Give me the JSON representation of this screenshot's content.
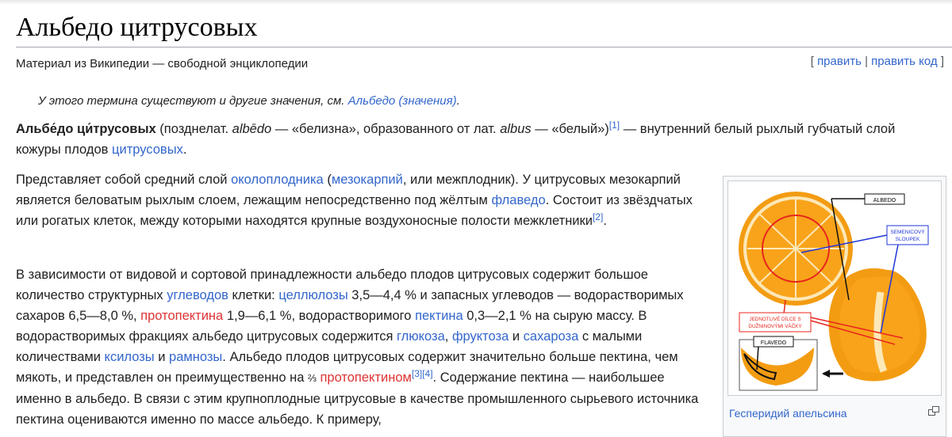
{
  "page": {
    "title": "Альбедо цитрусовых",
    "subtitle": "Материал из Википедии — свободной энциклопедии",
    "edit": "править",
    "edit_code": "править код"
  },
  "hatnote": {
    "text": "У этого термина существуют и другие значения, см. ",
    "link": "Альбедо (значения)",
    "end": "."
  },
  "p1": {
    "term": "Альбе́до ци́трусовых",
    "t1": " (позднелат. ",
    "w1": "albēdo",
    "t2": " — «белизна», образованного от лат. ",
    "w2": "albus",
    "t3": " — «белый»)",
    "ref1": "[1]",
    "t4": " — внутренний белый рыхлый губчатый слой кожуры плодов ",
    "link": "цитрусовых",
    "t5": "."
  },
  "p2": {
    "t1": "Представляет собой средний слой ",
    "l1": "околоплодника",
    "t2": " (",
    "l2": "мезокарпий",
    "t3": ", или межплодник). У цитрусовых мезокарпий является беловатым рыхлым слоем, лежащим непосредственно под жёлтым ",
    "l3": "флаведо",
    "t4": ". Состоит из звёздчатых или рогатых клеток, между которыми находятся крупные воздухоносные полости межклетники",
    "ref2": "[2]",
    "t5": "."
  },
  "p3": {
    "t1": "В зависимости от видовой и сортовой принадлежности альбедо плодов цитрусовых содержит большое количество структурных ",
    "l1": "углеводов",
    "t2": " клетки: ",
    "l2": "целлюлозы",
    "t3": " 3,5—4,4 % и запасных углеводов — водорастворимых сахаров 6,5—8,0 %, ",
    "l3": "протопектина",
    "t4": " 1,9—6,1 %, водорастворимого ",
    "l4": "пектина",
    "t5": " 0,3—2,1 % на сырую массу. В водорастворимых фракциях альбедо цитрусовых содержится ",
    "l5": "глюкоза",
    "t6": ", ",
    "l6": "фруктоза",
    "t7": " и ",
    "l7": "сахароза",
    "t8": " с малыми количествами ",
    "l8": "ксилозы",
    "t9": " и ",
    "l9": "рамнозы",
    "t10": ". Альбедо плодов цитрусовых содержит значительно больше пектина, чем мякоть, и представлен он преимущественно на ",
    "frac": "⅔",
    "t11": " ",
    "l10": "протопектином",
    "ref3": "[3]",
    "ref4": "[4]",
    "t12": ". Содержание пектина — наибольшее именно в альбедо. В связи с этим крупноплодные цитрусовые в качестве",
    "t13": "промышленного сырьевого источника пектина оцениваются именно по массе альбедо. К примеру,"
  },
  "figure": {
    "caption": "Гесперидий апельсина",
    "labels": {
      "albedo": "ALBEDO",
      "seminal1": "SEMENICOVÝ",
      "seminal2": "SLOUPEK",
      "segments1": "JEDNOTLIVÉ DÍLCE S",
      "segments2": "DUŽNINOVÝMI VÁČKY",
      "flavedo": "FLAVEDO"
    },
    "colors": {
      "orange": "#f59a0e",
      "albedo": "#fde8b8",
      "red_line": "#e8261c",
      "blue_line": "#1f35d8"
    }
  },
  "icons": {
    "enlarge": "enlarge-icon"
  }
}
